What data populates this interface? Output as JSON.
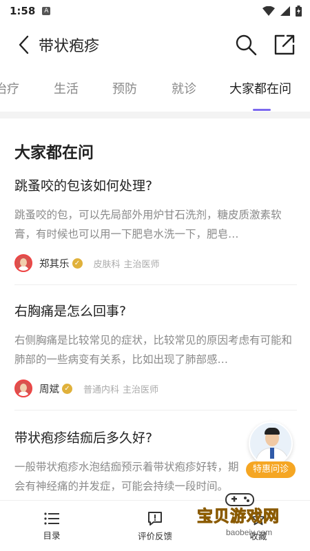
{
  "status_bar": {
    "time": "1:58",
    "app_badge": "A"
  },
  "header": {
    "title": "带状疱疹"
  },
  "tabs": [
    {
      "label": "治疗",
      "active": false
    },
    {
      "label": "生活",
      "active": false
    },
    {
      "label": "预防",
      "active": false
    },
    {
      "label": "就诊",
      "active": false
    },
    {
      "label": "大家都在问",
      "active": true
    }
  ],
  "section": {
    "title": "大家都在问"
  },
  "questions": [
    {
      "question": "跳蚤咬的包该如何处理?",
      "answer": "跳蚤咬的包，可以先局部外用炉甘石洗剂，糖皮质激素软膏，有时候也可以用一下肥皂水洗一下，肥皂…",
      "doctor": {
        "name": "郑其乐",
        "department": "皮肤科",
        "title": "主治医师"
      }
    },
    {
      "question": "右胸痛是怎么回事?",
      "answer": "右侧胸痛是比较常见的症状，比较常见的原因考虑有可能和肺部的一些病变有关系，比如出现了肺部感…",
      "doctor": {
        "name": "周斌",
        "department": "普通内科",
        "title": "主治医师"
      }
    },
    {
      "question": "带状疱疹结痂后多久好?",
      "answer": "一般带状疱疹水泡结痂预示着带状疱疹好转，期会有神经痛的并发症，可能会持续一段时间。带…",
      "doctor": null
    }
  ],
  "consult_button": {
    "label": "特惠问诊"
  },
  "bottom_bar": {
    "items": [
      {
        "label": "目录",
        "icon": "list-icon"
      },
      {
        "label": "评价反馈",
        "icon": "feedback-icon"
      },
      {
        "label": "收藏",
        "icon": "star-icon"
      }
    ]
  },
  "watermark": {
    "text": "宝贝游戏网",
    "url": "baobeiy.com"
  },
  "colors": {
    "accent": "#7b68ee",
    "verified": "#e0b13b",
    "consult": "#f5a623",
    "watermark": "#f2b21a"
  }
}
